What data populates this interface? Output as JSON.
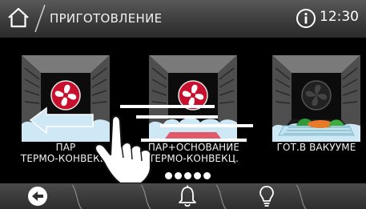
{
  "header": {
    "title": "ПРИГОТОВЛЕНИЕ",
    "time": "12:30",
    "home_icon": "home-icon",
    "info_icon": "info-icon"
  },
  "modes": [
    {
      "line1": "ПАР",
      "line2": "ТЕРМО-КОНВЕКЦ.",
      "icon": "fan-steam-icon"
    },
    {
      "line1": "ПАР+ОСНОВАНИЕ",
      "line2": "ТЕРМО-КОНВЕКЦ.",
      "icon": "fan-steam-bottom-heat-icon"
    },
    {
      "line1": "ГОТ.В ВАКУУМЕ",
      "line2": "",
      "icon": "vacuum-cooking-icon"
    }
  ],
  "pagination": {
    "pages": 5,
    "current": 1
  },
  "gesture_hint": {
    "direction": "swipe-left",
    "icon": "hand-swipe-icon"
  },
  "footer": {
    "back_icon": "back-icon",
    "bell_icon": "bell-icon",
    "light_icon": "light-bulb-icon"
  },
  "colors": {
    "fan_red": "#c8102e",
    "steam": "#cfe8f5",
    "topbar": "#4a4a4a"
  }
}
